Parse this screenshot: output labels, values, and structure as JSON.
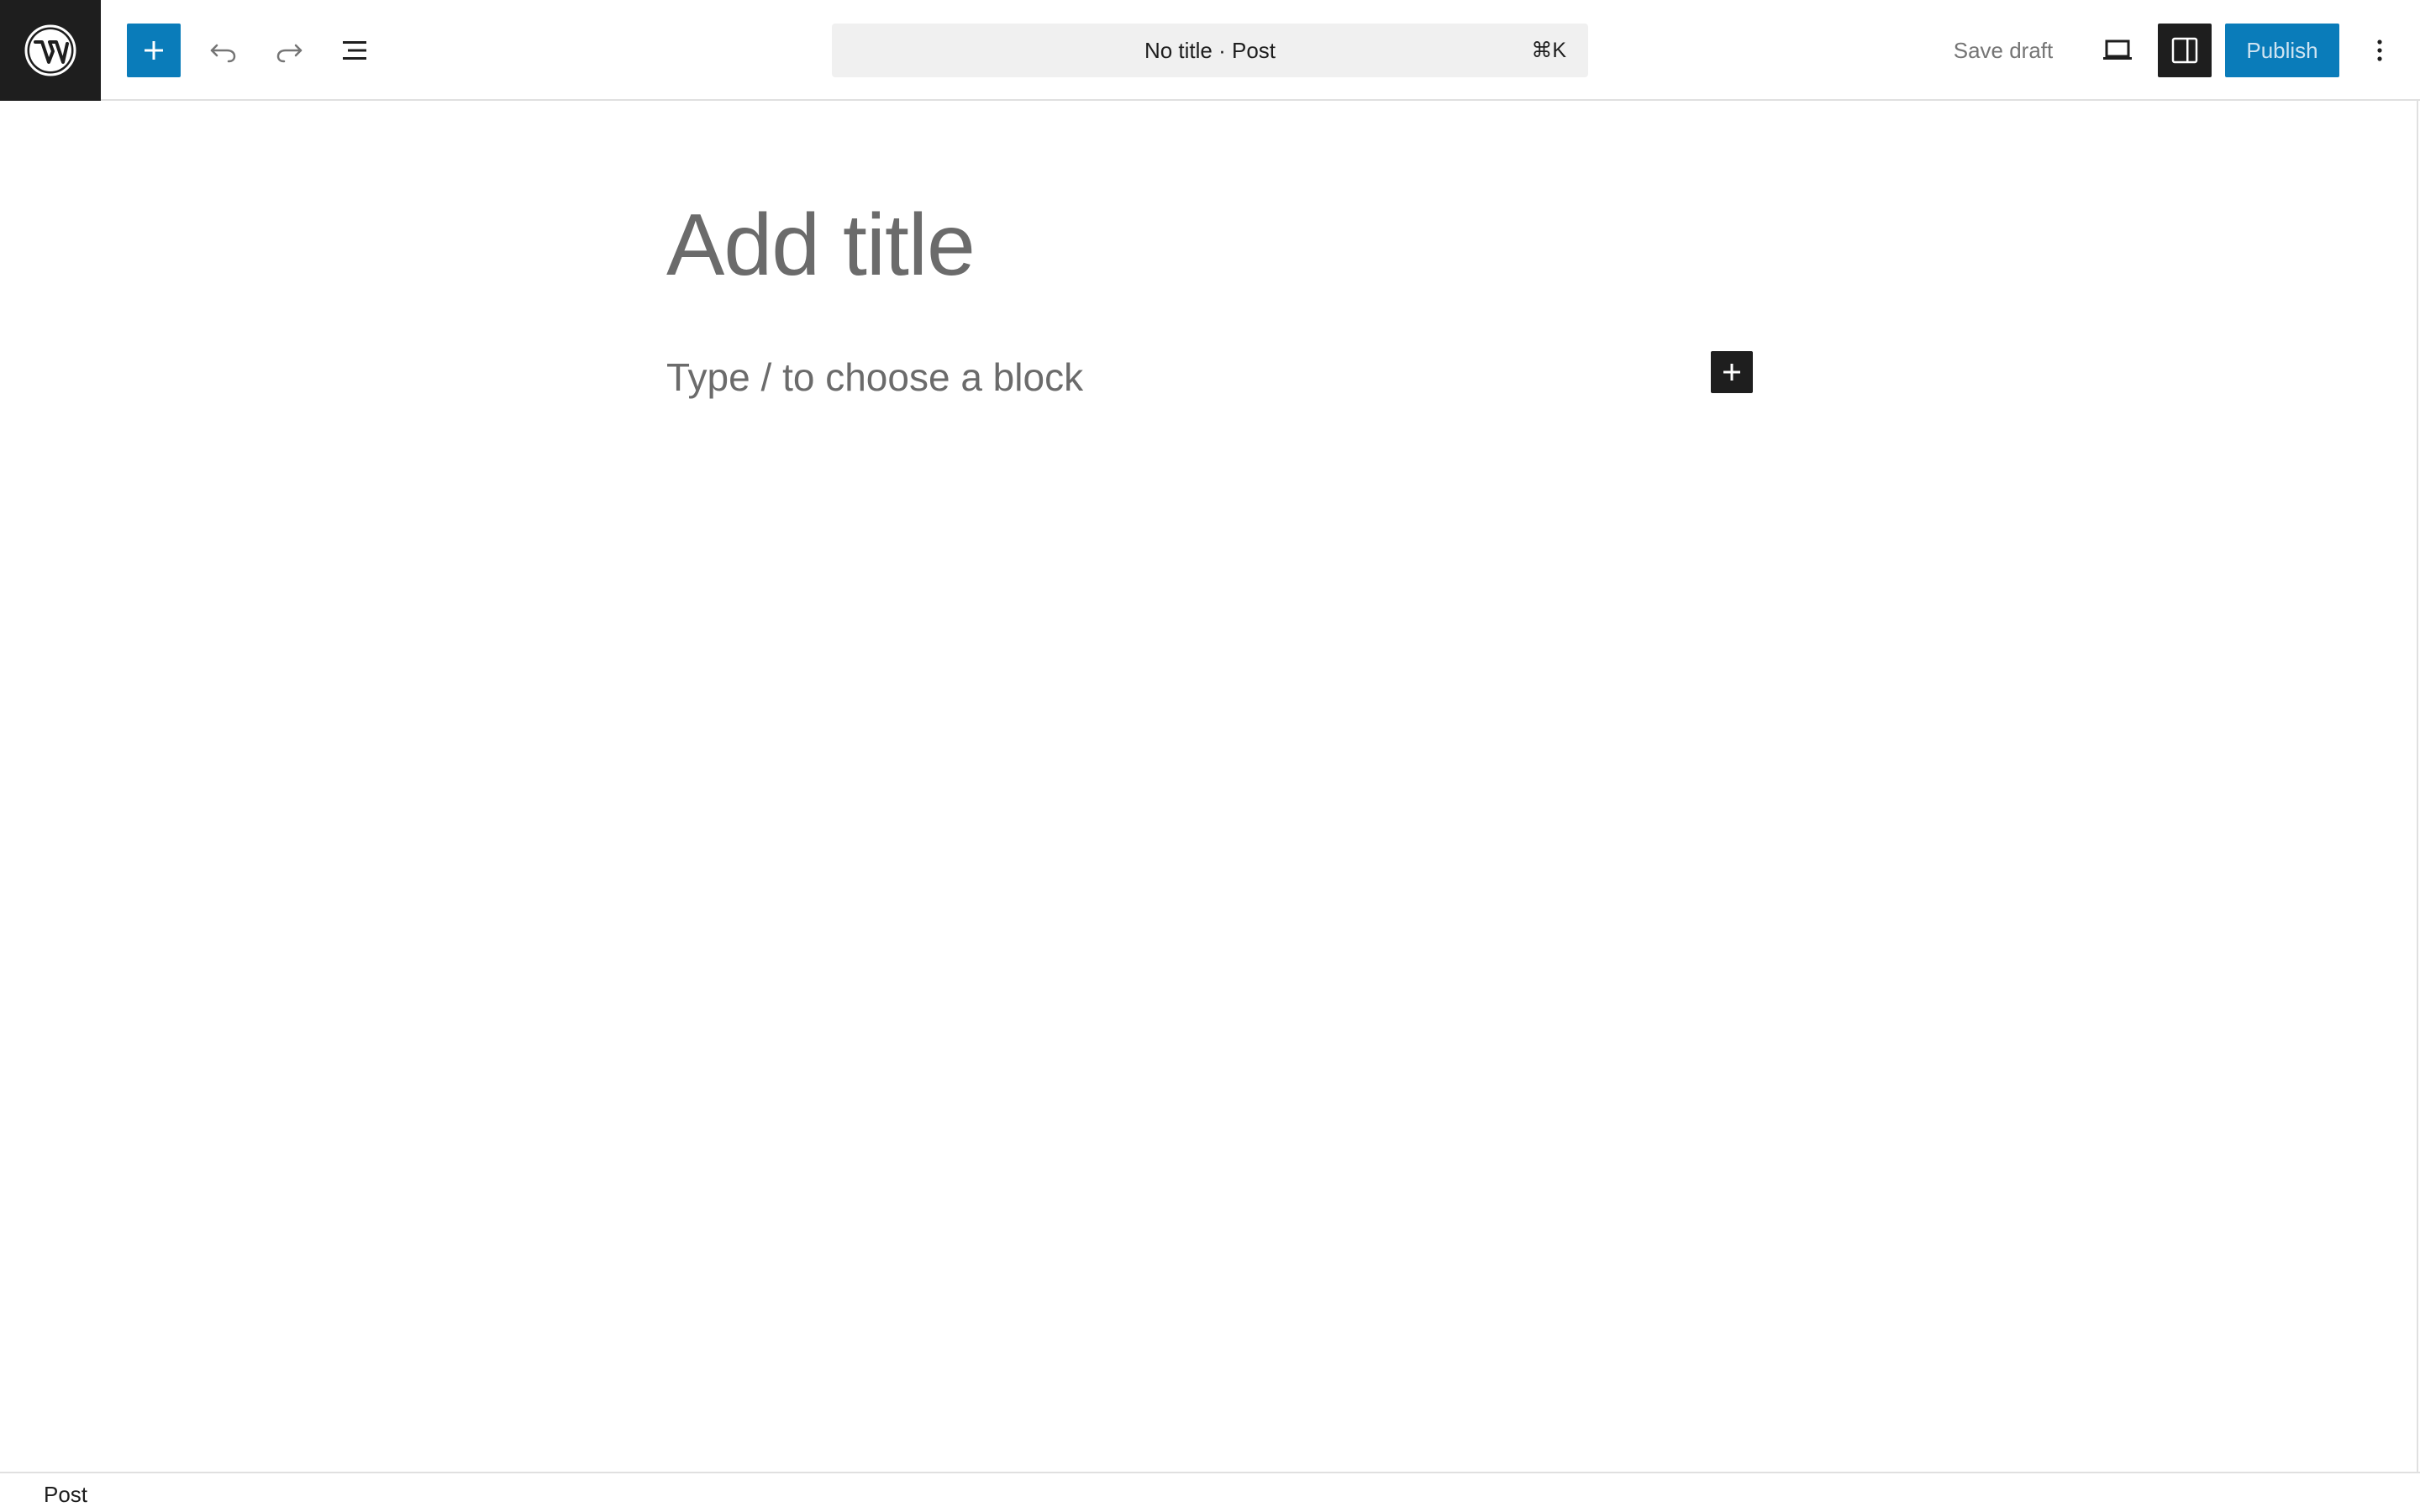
{
  "header": {
    "logo_icon": "wordpress-logo-icon",
    "toolbar": {
      "inserter_icon": "plus-icon",
      "undo_icon": "undo-icon",
      "redo_icon": "redo-icon",
      "list_view_icon": "list-view-icon"
    },
    "command_bar": {
      "title": "No title · Post",
      "shortcut": "⌘K"
    },
    "actions": {
      "save_draft_label": "Save draft",
      "preview_icon": "laptop-icon",
      "settings_icon": "sidebar-icon",
      "publish_label": "Publish",
      "options_icon": "more-vertical-icon"
    }
  },
  "editor": {
    "title_placeholder": "Add title",
    "block_placeholder": "Type / to choose a block",
    "block_inserter_icon": "plus-icon"
  },
  "footer": {
    "breadcrumb": "Post"
  },
  "colors": {
    "accent": "#0a7cba",
    "dark": "#1e1e1e",
    "placeholder_text": "#6b6b6b",
    "muted_text": "#757575",
    "command_bar_bg": "#f0f0f0",
    "border": "#e0e0e0"
  }
}
